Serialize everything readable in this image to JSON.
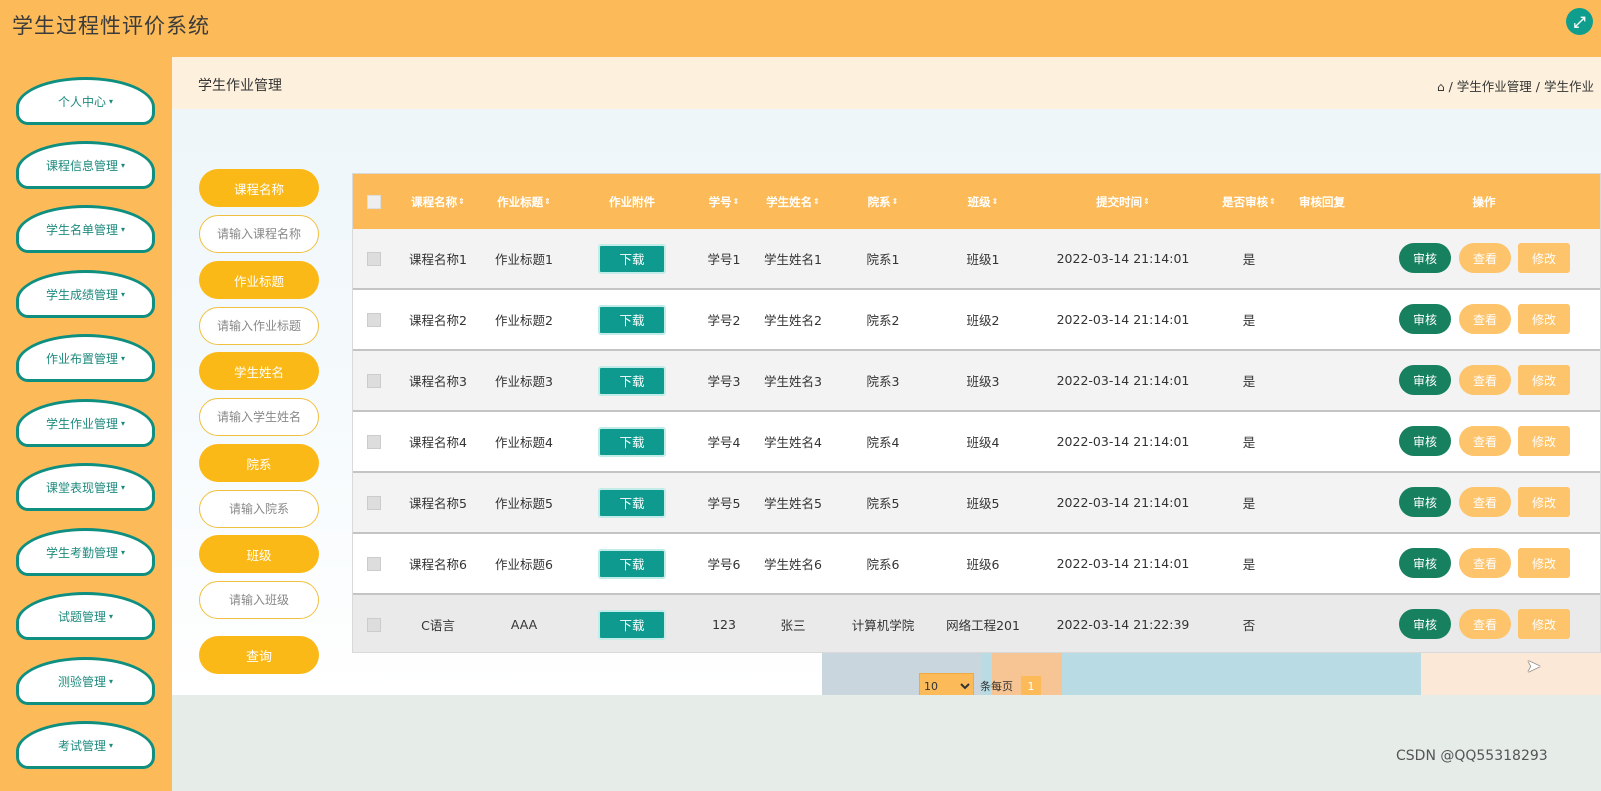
{
  "app": {
    "title": "学生过程性评价系统"
  },
  "sidebar": {
    "items": [
      {
        "label": "个人中心"
      },
      {
        "label": "课程信息管理"
      },
      {
        "label": "学生名单管理"
      },
      {
        "label": "学生成绩管理"
      },
      {
        "label": "作业布置管理"
      },
      {
        "label": "学生作业管理"
      },
      {
        "label": "课堂表现管理"
      },
      {
        "label": "学生考勤管理"
      },
      {
        "label": "试题管理"
      },
      {
        "label": "测验管理"
      },
      {
        "label": "考试管理"
      }
    ]
  },
  "header": {
    "page_title": "学生作业管理",
    "breadcrumb": "/ 学生作业管理 / 学生作业"
  },
  "search": {
    "fields": [
      {
        "label": "课程名称",
        "placeholder": "请输入课程名称"
      },
      {
        "label": "作业标题",
        "placeholder": "请输入作业标题"
      },
      {
        "label": "学生姓名",
        "placeholder": "请输入学生姓名"
      },
      {
        "label": "院系",
        "placeholder": "请输入院系"
      },
      {
        "label": "班级",
        "placeholder": "请输入班级"
      }
    ],
    "query_label": "查询"
  },
  "table": {
    "columns": [
      "课程名称",
      "作业标题",
      "作业附件",
      "学号",
      "学生姓名",
      "院系",
      "班级",
      "提交时间",
      "是否审核",
      "审核回复",
      "操作"
    ],
    "download_label": "下载",
    "actions": {
      "audit": "审核",
      "view": "查看",
      "edit": "修改"
    },
    "rows": [
      {
        "course": "课程名称1",
        "title": "作业标题1",
        "student_no": "学号1",
        "student_name": "学生姓名1",
        "dept": "院系1",
        "class": "班级1",
        "submit_time": "2022-03-14 21:14:01",
        "reviewed": "是",
        "reply": ""
      },
      {
        "course": "课程名称2",
        "title": "作业标题2",
        "student_no": "学号2",
        "student_name": "学生姓名2",
        "dept": "院系2",
        "class": "班级2",
        "submit_time": "2022-03-14 21:14:01",
        "reviewed": "是",
        "reply": ""
      },
      {
        "course": "课程名称3",
        "title": "作业标题3",
        "student_no": "学号3",
        "student_name": "学生姓名3",
        "dept": "院系3",
        "class": "班级3",
        "submit_time": "2022-03-14 21:14:01",
        "reviewed": "是",
        "reply": ""
      },
      {
        "course": "课程名称4",
        "title": "作业标题4",
        "student_no": "学号4",
        "student_name": "学生姓名4",
        "dept": "院系4",
        "class": "班级4",
        "submit_time": "2022-03-14 21:14:01",
        "reviewed": "是",
        "reply": ""
      },
      {
        "course": "课程名称5",
        "title": "作业标题5",
        "student_no": "学号5",
        "student_name": "学生姓名5",
        "dept": "院系5",
        "class": "班级5",
        "submit_time": "2022-03-14 21:14:01",
        "reviewed": "是",
        "reply": ""
      },
      {
        "course": "课程名称6",
        "title": "作业标题6",
        "student_no": "学号6",
        "student_name": "学生姓名6",
        "dept": "院系6",
        "class": "班级6",
        "submit_time": "2022-03-14 21:14:01",
        "reviewed": "是",
        "reply": ""
      },
      {
        "course": "C语言",
        "title": "AAA",
        "student_no": "123",
        "student_name": "张三",
        "dept": "计算机学院",
        "class": "网络工程201",
        "submit_time": "2022-03-14 21:22:39",
        "reviewed": "否",
        "reply": ""
      }
    ]
  },
  "pagination": {
    "page_size": "10",
    "per_page_label": "条每页",
    "current_page": "1"
  },
  "watermark": "CSDN @QQ55318293",
  "icons": {
    "fullscreen": "expand-icon",
    "home": "home-icon",
    "menu_caret": "caret-down-icon",
    "sort": "sort-icon"
  },
  "colors": {
    "primary": "#fcbb58",
    "accent": "#0f9a8f",
    "audit": "#17805f",
    "button_yellow": "#fbb917"
  }
}
